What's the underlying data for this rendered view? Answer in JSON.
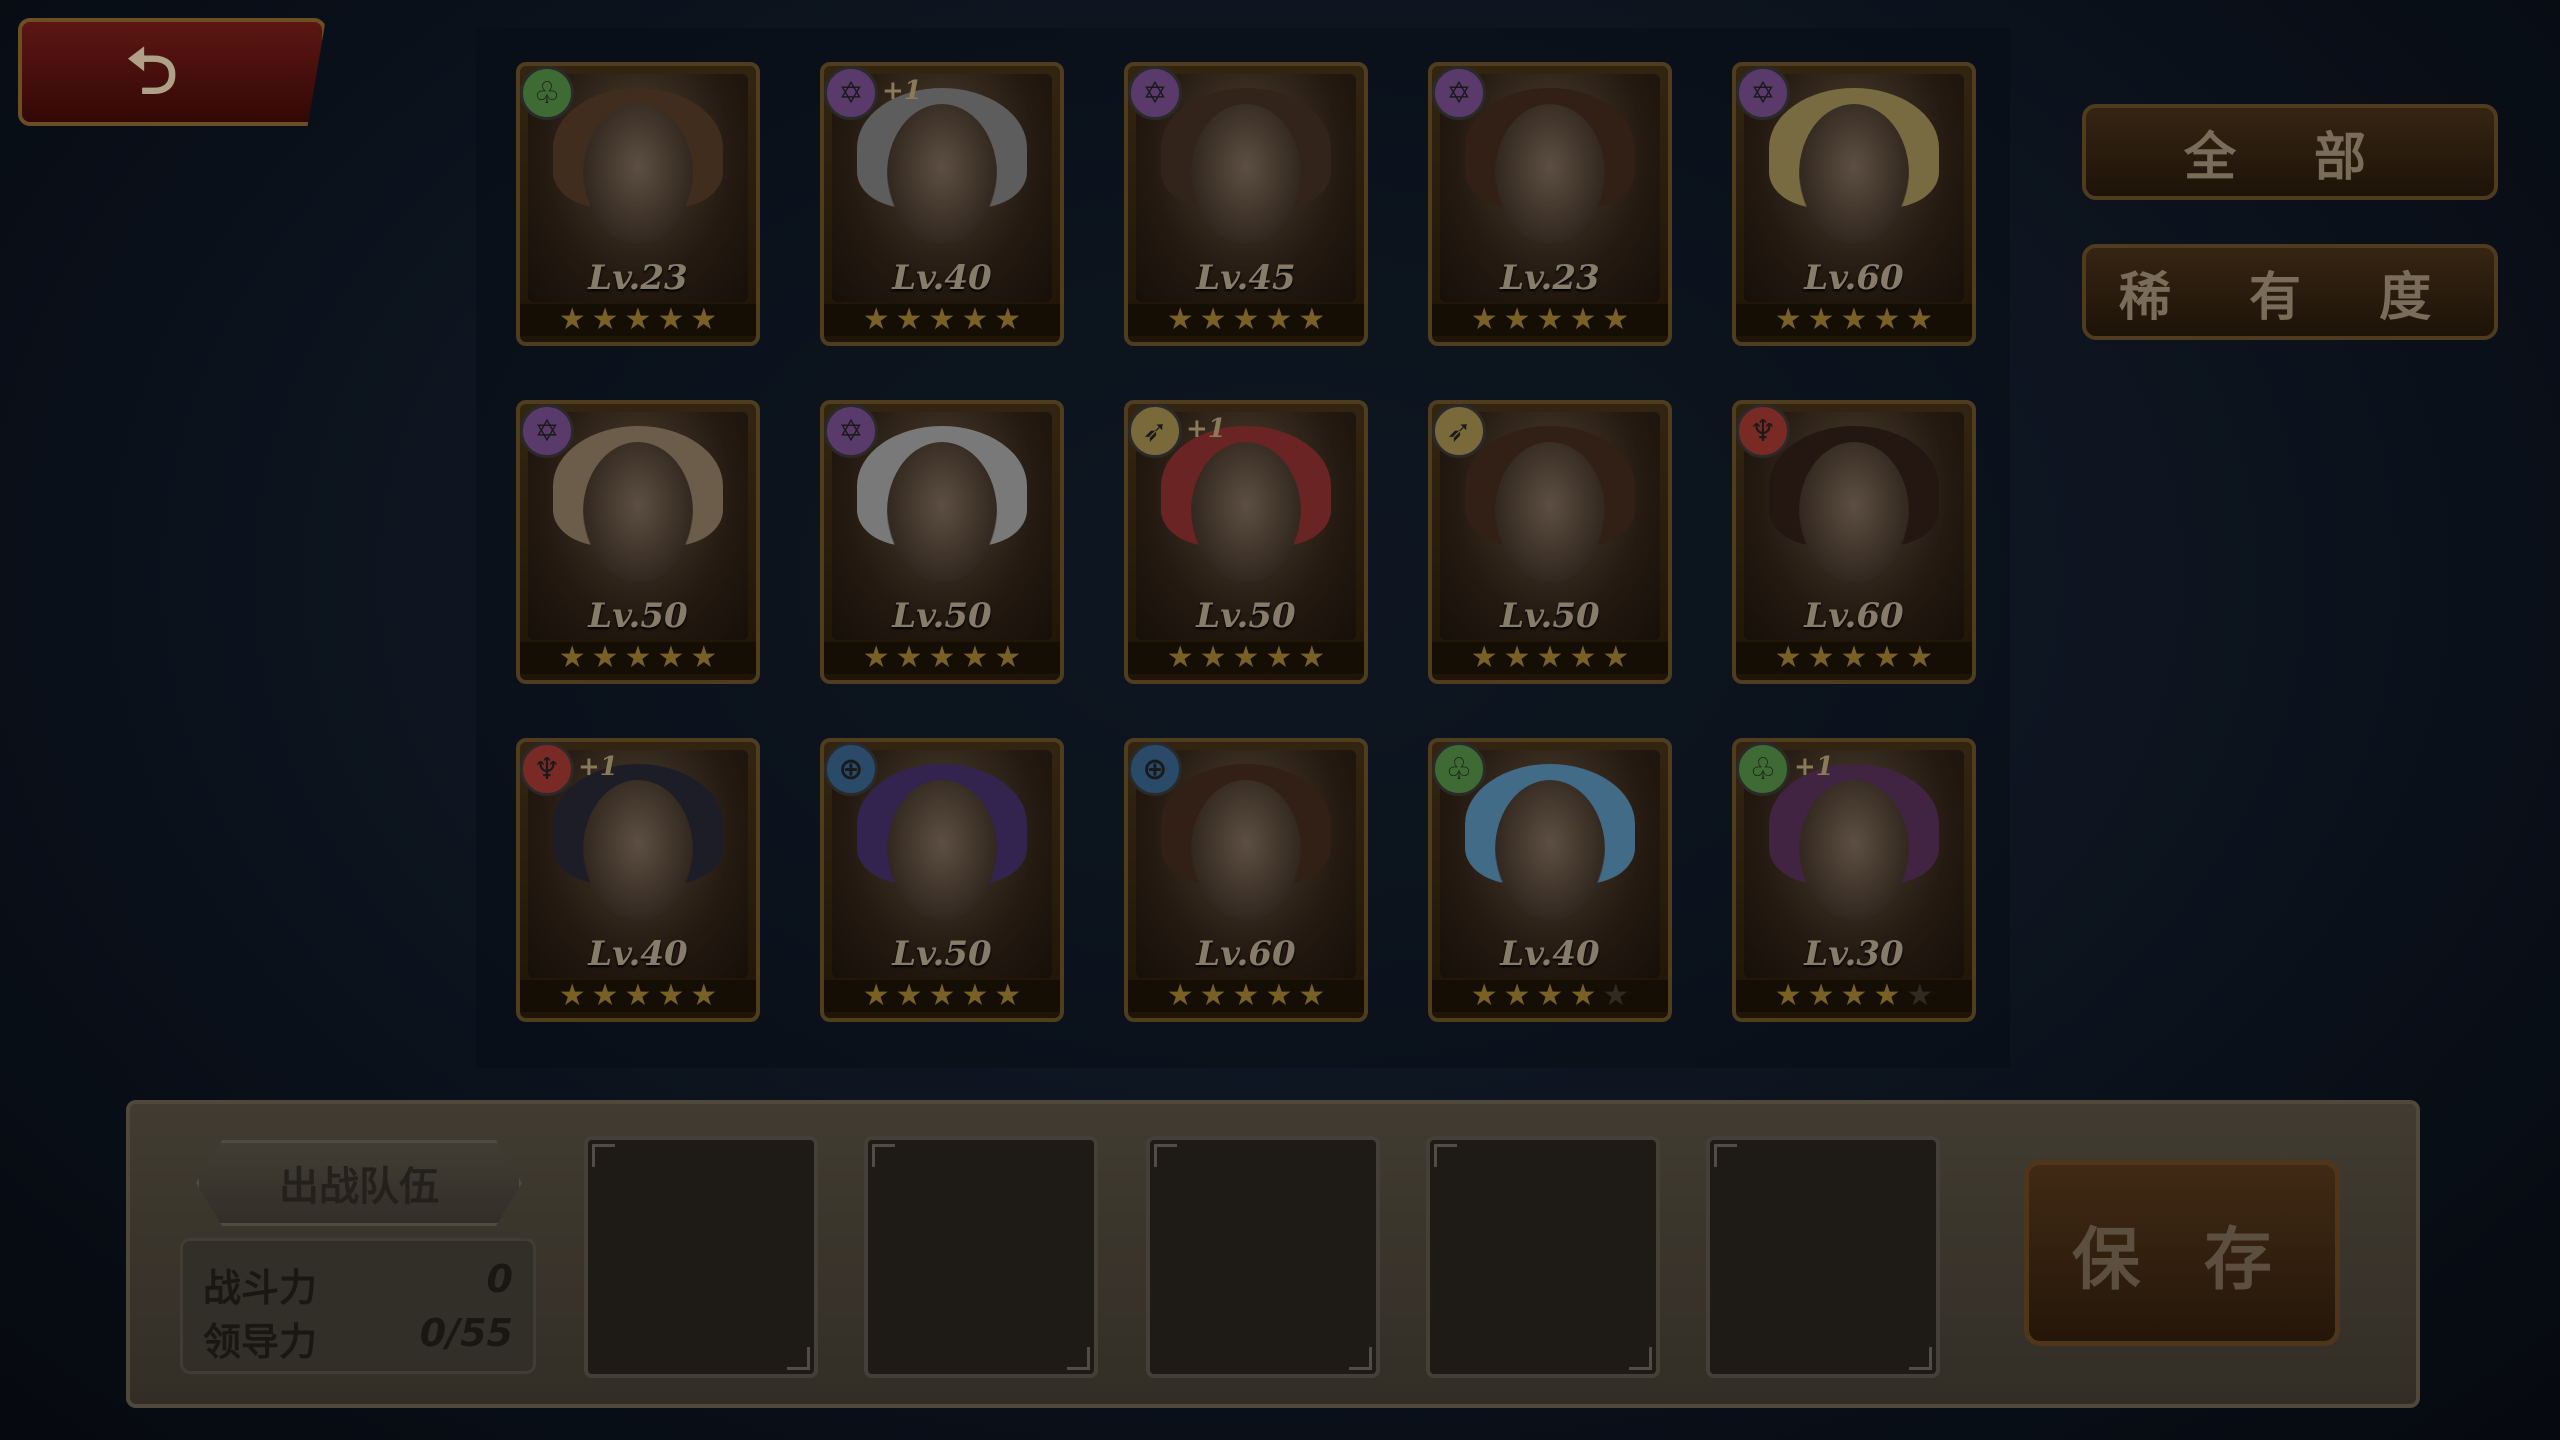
{
  "back_button": {
    "icon": "back-arrow-icon",
    "glyph": "⮌"
  },
  "filters": {
    "all_label": "全 部",
    "rarity_label": "稀 有 度"
  },
  "cards": [
    {
      "level": "Lv.23",
      "stars": 5,
      "element": "green",
      "plus": "",
      "hair": "#4a3422"
    },
    {
      "level": "Lv.40",
      "stars": 5,
      "element": "purple",
      "plus": "+1",
      "hair": "#6a6a6a"
    },
    {
      "level": "Lv.45",
      "stars": 5,
      "element": "purple",
      "plus": "",
      "hair": "#3a2a1e"
    },
    {
      "level": "Lv.23",
      "stars": 5,
      "element": "purple",
      "plus": "",
      "hair": "#3a2418"
    },
    {
      "level": "Lv.60",
      "stars": 5,
      "element": "purple",
      "plus": "",
      "hair": "#8a7a4a"
    },
    {
      "level": "Lv.50",
      "stars": 5,
      "element": "purple",
      "plus": "",
      "hair": "#7a6a54"
    },
    {
      "level": "Lv.50",
      "stars": 5,
      "element": "purple",
      "plus": "",
      "hair": "#8a8a8a"
    },
    {
      "level": "Lv.50",
      "stars": 5,
      "element": "gold",
      "plus": "+1",
      "hair": "#7a2a2a"
    },
    {
      "level": "Lv.50",
      "stars": 5,
      "element": "gold",
      "plus": "",
      "hair": "#3a2418"
    },
    {
      "level": "Lv.60",
      "stars": 5,
      "element": "red",
      "plus": "",
      "hair": "#2a1a14"
    },
    {
      "level": "Lv.40",
      "stars": 5,
      "element": "red",
      "plus": "+1",
      "hair": "#22222e"
    },
    {
      "level": "Lv.50",
      "stars": 5,
      "element": "blue",
      "plus": "",
      "hair": "#3a2a5a"
    },
    {
      "level": "Lv.60",
      "stars": 5,
      "element": "blue",
      "plus": "",
      "hair": "#3a2418"
    },
    {
      "level": "Lv.40",
      "stars": 4,
      "element": "green",
      "plus": "",
      "hair": "#4a7a9a"
    },
    {
      "level": "Lv.30",
      "stars": 4,
      "element": "green",
      "plus": "+1",
      "hair": "#4a2a4a"
    }
  ],
  "element_icons": {
    "green": "♧",
    "purple": "✡",
    "gold": "➶",
    "red": "♆",
    "blue": "⊕"
  },
  "team": {
    "label": "出战队伍",
    "power_label": "战斗力",
    "power_value": "0",
    "leadership_label": "领导力",
    "leadership_value": "0/55",
    "slot_count": 5
  },
  "save_label": "保 存"
}
